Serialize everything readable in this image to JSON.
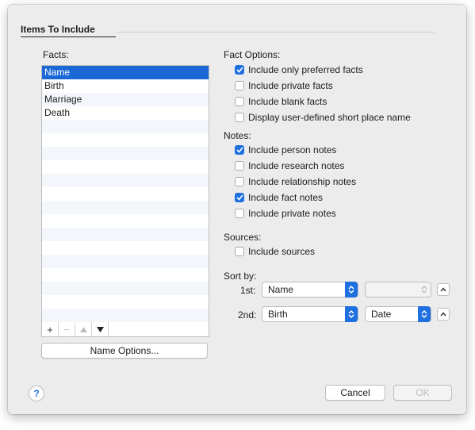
{
  "group": {
    "title": "Items To Include"
  },
  "facts": {
    "label": "Facts:",
    "items": [
      "Name",
      "Birth",
      "Marriage",
      "Death"
    ],
    "selected": "Name",
    "name_options_label": "Name Options..."
  },
  "fact_options": {
    "label": "Fact Options:",
    "items": [
      {
        "label": "Include only preferred facts",
        "checked": true
      },
      {
        "label": "Include private facts",
        "checked": false
      },
      {
        "label": "Include blank facts",
        "checked": false
      },
      {
        "label": "Display user-defined short place name",
        "checked": false
      }
    ]
  },
  "notes": {
    "label": "Notes:",
    "items": [
      {
        "label": "Include person notes",
        "checked": true
      },
      {
        "label": "Include research notes",
        "checked": false
      },
      {
        "label": "Include relationship notes",
        "checked": false
      },
      {
        "label": "Include fact notes",
        "checked": true
      },
      {
        "label": "Include private notes",
        "checked": false
      }
    ]
  },
  "sources": {
    "label": "Sources:",
    "items": [
      {
        "label": "Include sources",
        "checked": false
      }
    ]
  },
  "sort_by": {
    "label": "Sort by:",
    "first": {
      "label": "1st:",
      "value": "Name",
      "secondary": ""
    },
    "second": {
      "label": "2nd:",
      "value": "Birth",
      "secondary": "Date"
    }
  },
  "footer": {
    "help": "?",
    "cancel": "Cancel",
    "ok": "OK"
  },
  "colors": {
    "accent": "#1e6fe0",
    "selection": "#1a68d6"
  }
}
